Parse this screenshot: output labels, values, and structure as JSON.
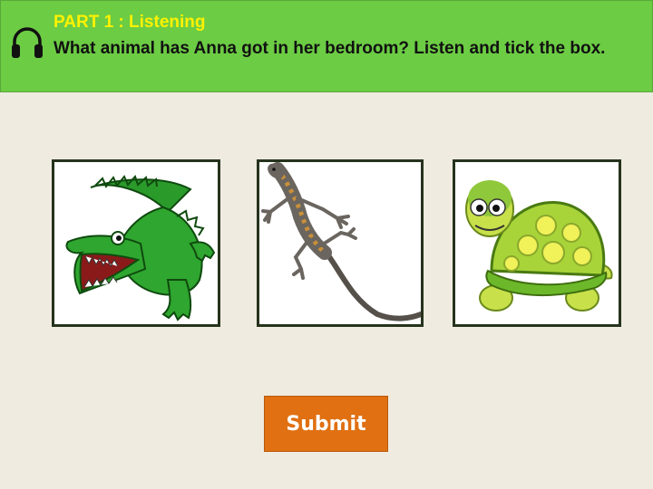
{
  "header": {
    "part_title": "PART 1 : Listening",
    "question": "What animal has Anna got in her bedroom? Listen and tick the box.",
    "background": "#6ccc44",
    "title_color": "#fff200"
  },
  "options": [
    {
      "animal": "crocodile-picture"
    },
    {
      "animal": "lizard-picture"
    },
    {
      "animal": "turtle-picture"
    }
  ],
  "submit": {
    "label": "Submit",
    "color": "#e07012"
  }
}
